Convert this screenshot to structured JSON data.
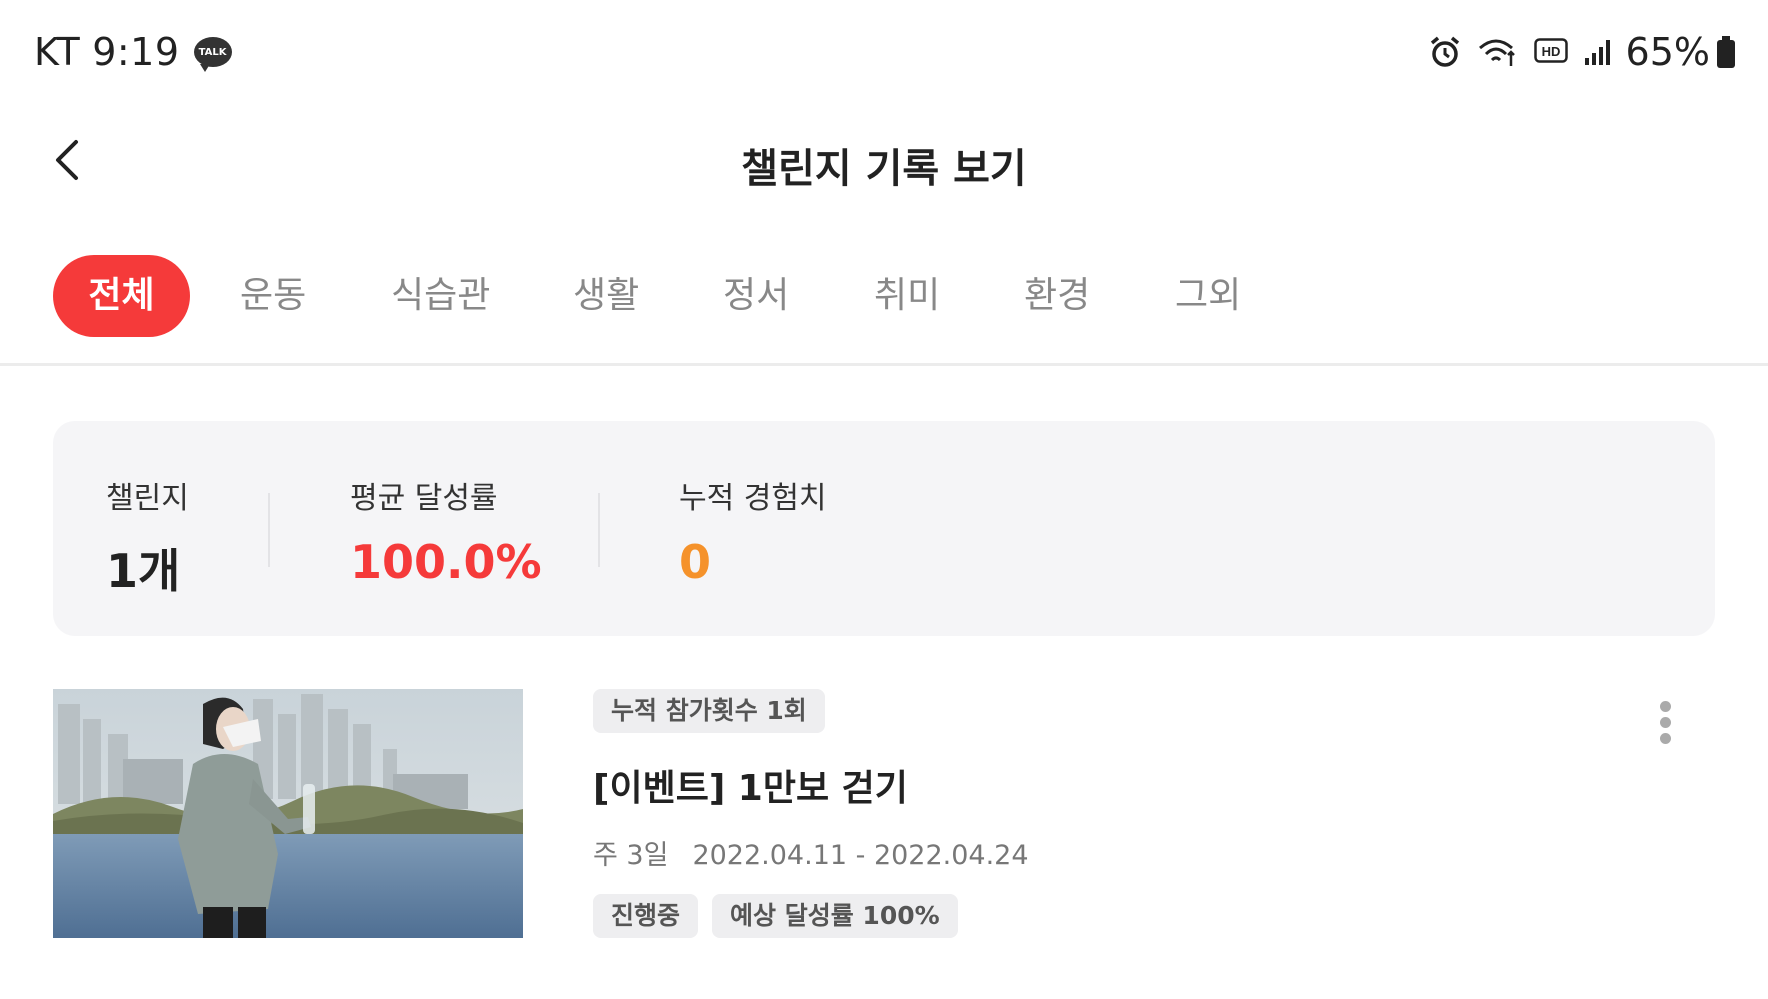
{
  "status_bar": {
    "carrier": "KT",
    "time": "9:19",
    "talk_badge": "TALK",
    "battery_percent": "65%",
    "icons": [
      "kakaotalk-icon",
      "alarm-icon",
      "wifi-icon",
      "hd-icon",
      "signal-icon",
      "battery-icon"
    ]
  },
  "header": {
    "title": "챌린지 기록 보기",
    "back_icon": "chevron-left-icon"
  },
  "tabs": [
    {
      "label": "전체",
      "active": true
    },
    {
      "label": "운동",
      "active": false
    },
    {
      "label": "식습관",
      "active": false
    },
    {
      "label": "생활",
      "active": false
    },
    {
      "label": "정서",
      "active": false
    },
    {
      "label": "취미",
      "active": false
    },
    {
      "label": "환경",
      "active": false
    },
    {
      "label": "그외",
      "active": false
    }
  ],
  "summary": {
    "challenges": {
      "label": "챌린지",
      "value": "1개"
    },
    "avg_rate": {
      "label": "평균 달성률",
      "value": "100.0%"
    },
    "exp": {
      "label": "누적 경험치",
      "value": "0"
    }
  },
  "challenge_item": {
    "participation_chip": "누적 참가횟수 1회",
    "title": "[이벤트] 1만보 걷기",
    "frequency": "주 3일",
    "period": "2022.04.11 - 2022.04.24",
    "status_chip": "진행중",
    "expected_chip": "예상 달성률 100%",
    "more_icon": "more-vertical-icon"
  },
  "colors": {
    "accent": "#f53a3a",
    "rate_red": "#f53a3a",
    "exp_orange": "#f5922b",
    "card_bg": "#f5f5f7",
    "chip_bg": "#eeeef0"
  }
}
